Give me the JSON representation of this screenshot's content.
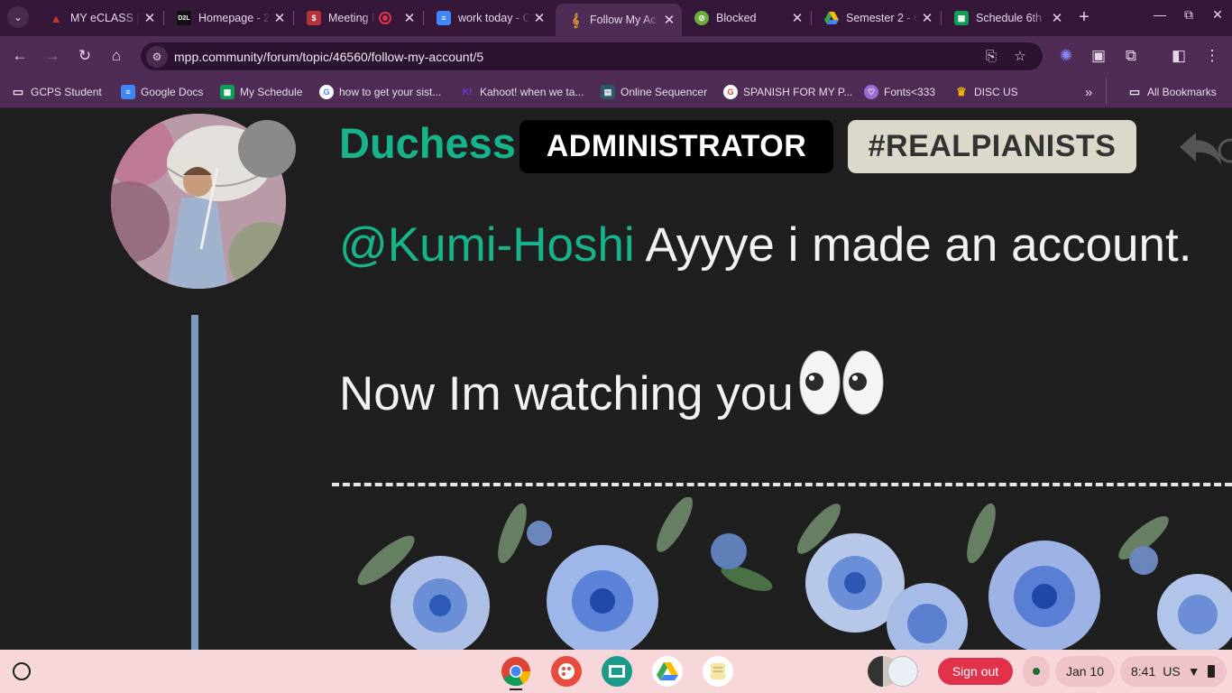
{
  "browser": {
    "tabs": [
      {
        "title": "MY eCLASS | ",
        "favicon": "eclass-icon",
        "color": "#8c1f2a"
      },
      {
        "title": "Homepage - 2",
        "favicon": "d2l-icon",
        "color": "#111111"
      },
      {
        "title": "Meeting R",
        "favicon": "meeting-icon",
        "color": "#b5333b",
        "recording": true
      },
      {
        "title": "work today - G",
        "favicon": "docs-icon",
        "color": "#4285f4"
      },
      {
        "title": "Follow My Ac",
        "favicon": "mpp-icon",
        "color": "#e0a030",
        "active": true
      },
      {
        "title": "Blocked",
        "favicon": "blocked-icon",
        "color": "#6cae3a"
      },
      {
        "title": "Semester 2 - G",
        "favicon": "drive-icon",
        "color": "#34a853"
      },
      {
        "title": "Schedule 6th",
        "favicon": "sheets-icon",
        "color": "#0f9d58"
      }
    ],
    "url": "mpp.community/forum/topic/46560/follow-my-account/5",
    "bookmarks": [
      {
        "label": "GCPS Student",
        "icon": "folder-apps-icon"
      },
      {
        "label": "Google Docs",
        "icon": "docs-icon"
      },
      {
        "label": "My Schedule",
        "icon": "sheets-icon"
      },
      {
        "label": "how to get your sist...",
        "icon": "google-icon"
      },
      {
        "label": "Kahoot! when we ta...",
        "icon": "kahoot-icon"
      },
      {
        "label": "Online Sequencer",
        "icon": "sequencer-icon"
      },
      {
        "label": "SPANISH FOR MY P...",
        "icon": "google-icon"
      },
      {
        "label": "Fonts<333",
        "icon": "fonts-icon"
      },
      {
        "label": "DISC US",
        "icon": "crown-icon"
      }
    ],
    "all_bookmarks": "All Bookmarks"
  },
  "post": {
    "username": "Duchess",
    "badges": [
      "ADMINISTRATOR",
      "#REALPIANISTS"
    ],
    "mention": "@Kumi-Hoshi",
    "line1": " Ayyye i made an account.",
    "line2": "Now Im watching you",
    "emoji": "eyes-emoji"
  },
  "shelf": {
    "apps": [
      "chrome-icon",
      "canvas-icon",
      "classroom-icon",
      "drive-icon",
      "keep-icon"
    ],
    "sign_out": "Sign out",
    "date": "Jan 10",
    "time": "8:41",
    "locale": "US"
  },
  "colors": {
    "accent": "#17b38b",
    "tabstrip": "#35173a",
    "toolbar": "#4f2c55",
    "shelf": "#f7d7d9"
  }
}
